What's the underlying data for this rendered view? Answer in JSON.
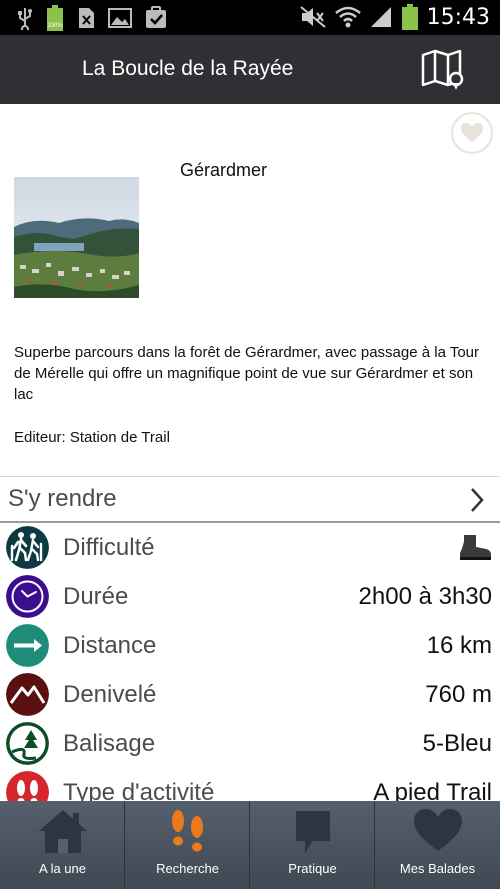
{
  "status_bar": {
    "time": "15:43",
    "battery_label": "100%",
    "icons": [
      "usb-icon",
      "battery-icon",
      "no-sim-icon",
      "image-icon",
      "task-icon",
      "mute-icon",
      "wifi-icon",
      "signal-icon",
      "battery-icon"
    ]
  },
  "app_bar": {
    "title": "La Boucle de la Rayée",
    "action_icon": "map-icon"
  },
  "detail": {
    "place_name": "Gérardmer",
    "description": "Superbe parcours dans la forêt de Gérardmer, avec passage à la Tour de Mérelle qui offre un magnifique point de vue sur Gérardmer et son lac",
    "editor": "Editeur: Station de Trail",
    "get_there": "S'y rendre"
  },
  "attributes": [
    {
      "label": "Difficulté",
      "value": "",
      "icon": "hikers-icon",
      "color": "#0d3a40",
      "value_icon": "boot-icon"
    },
    {
      "label": "Durée",
      "value": "2h00 à 3h30",
      "icon": "clock-icon",
      "color": "#3a0e8f"
    },
    {
      "label": "Distance",
      "value": "16 km",
      "icon": "arrow-right-icon",
      "color": "#1f8c7a"
    },
    {
      "label": "Denivelé",
      "value": "760 m",
      "icon": "mountain-icon",
      "color": "#5a1010"
    },
    {
      "label": "Balisage",
      "value": "5-Bleu",
      "icon": "trail-marker-icon",
      "color": "#0a4d26"
    },
    {
      "label": "Type d'activité",
      "value": "A pied Trail",
      "icon": "footprints-icon",
      "color": "#d4262c"
    }
  ],
  "bottom_nav": [
    {
      "label": "A la une",
      "icon": "home-icon",
      "color": "#2f3540"
    },
    {
      "label": "Recherche",
      "icon": "footprints-icon",
      "color": "#ec7a1c"
    },
    {
      "label": "Pratique",
      "icon": "bookmark-icon",
      "color": "#2f3540"
    },
    {
      "label": "Mes Balades",
      "icon": "heart-icon",
      "color": "#2f3540"
    }
  ]
}
